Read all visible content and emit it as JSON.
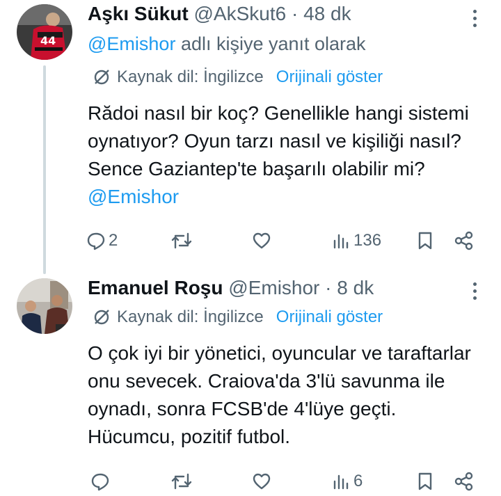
{
  "tweets": [
    {
      "author_name": "Aşkı Sükut",
      "handle": "@AkSkut6",
      "separator": "·",
      "time": "48 dk",
      "replying_handle": "@Emishor",
      "replying_suffix": " adlı kişiye yanıt olarak",
      "source_language": "Kaynak dil: İngilizce",
      "show_original": "Orijinali göster",
      "text": "Rădoi nasıl bir koç? Genellikle hangi sistemi oynatıyor? Oyun tarzı nasıl ve kişiliği nasıl? Sence Gaziantep'te başarılı olabilir mi? ",
      "text_mention": "@Emishor",
      "reply_count": "2",
      "repost_count": "",
      "like_count": "",
      "view_count": "136"
    },
    {
      "author_name": "Emanuel Roşu",
      "handle": "@Emishor",
      "separator": "·",
      "time": "8 dk",
      "source_language": "Kaynak dil: İngilizce",
      "show_original": "Orijinali göster",
      "text": "O çok iyi bir yönetici, oyuncular ve taraftarlar onu sevecek. Craiova'da 3'lü savunma ile oynadı, sonra FCSB'de 4'lüye geçti. Hücumcu, pozitif futbol.",
      "reply_count": "",
      "repost_count": "",
      "like_count": "",
      "view_count": "6"
    }
  ],
  "colors": {
    "text": "#0f1419",
    "muted": "#536471",
    "accent": "#1d9bf0",
    "thread_line": "#cfd9de"
  }
}
